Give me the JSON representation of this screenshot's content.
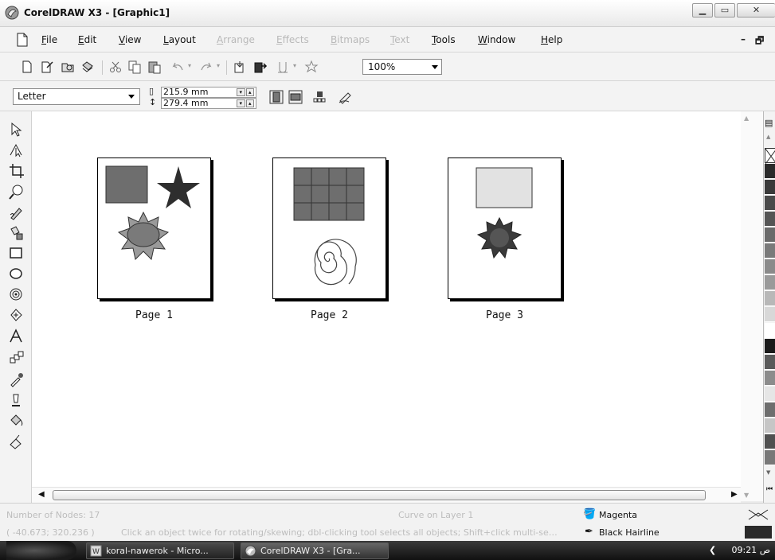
{
  "window": {
    "title": "CorelDRAW X3 - [Graphic1]"
  },
  "menu": {
    "items": [
      {
        "label": "File",
        "enabled": true
      },
      {
        "label": "Edit",
        "enabled": true
      },
      {
        "label": "View",
        "enabled": true
      },
      {
        "label": "Layout",
        "enabled": true
      },
      {
        "label": "Arrange",
        "enabled": false
      },
      {
        "label": "Effects",
        "enabled": false
      },
      {
        "label": "Bitmaps",
        "enabled": false
      },
      {
        "label": "Text",
        "enabled": false
      },
      {
        "label": "Tools",
        "enabled": true
      },
      {
        "label": "Window",
        "enabled": true
      },
      {
        "label": "Help",
        "enabled": true
      }
    ]
  },
  "toolbar": {
    "zoom": "100%"
  },
  "propertybar": {
    "paper": "Letter",
    "width": "215.9 mm",
    "height": "279.4 mm"
  },
  "pages": [
    {
      "label": "Page 1"
    },
    {
      "label": "Page 2"
    },
    {
      "label": "Page 3"
    }
  ],
  "status": {
    "nodes": "Number of Nodes: 17",
    "layer": "Curve on Layer 1",
    "coords": "( -40.673; 320.236 )",
    "hint": "Click an object twice for rotating/skewing; dbl-clicking tool selects all objects; Shift+click multi-se…",
    "fill": "Magenta",
    "outline": "Black Hairline"
  },
  "palette_colors": [
    "#2a2a2a",
    "#3a3a3a",
    "#4a4a4a",
    "#555555",
    "#6a6a6a",
    "#7a7a7a",
    "#8a8a8a",
    "#9a9a9a",
    "#b8b8b8",
    "#d8d8d8",
    "#ffffff",
    "#1a1a1a",
    "#5a5a5a",
    "#8c8c8c",
    "#e6e6e6",
    "#6e6e6e",
    "#c6c6c6",
    "#505050",
    "#787878"
  ],
  "taskbar": {
    "tasks": [
      {
        "label": "koral-nawerok - Micro..."
      },
      {
        "label": "CorelDRAW X3 - [Gra..."
      }
    ],
    "clock": "09:21 ص"
  }
}
